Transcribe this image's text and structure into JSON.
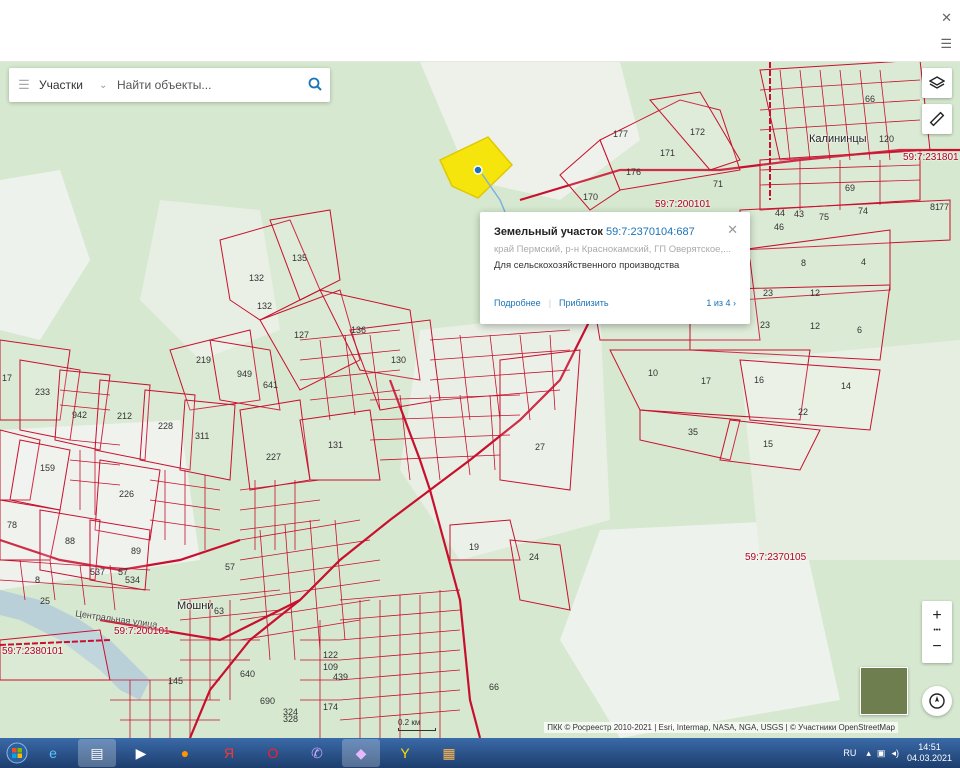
{
  "search": {
    "layer_label": "Участки",
    "placeholder": "Найти объекты..."
  },
  "popup": {
    "title_prefix": "Земельный участок",
    "cadastral_number": "59:7:2370104:687",
    "address": "край Пермский, р-н Краснокамский, ГП Оверятское,...",
    "usage": "Для сельскохозяйственного производства",
    "link_more": "Подробнее",
    "link_zoom": "Приблизить",
    "count": "1 из 4"
  },
  "map": {
    "villages": [
      "Калининцы",
      "Мошни"
    ],
    "street": "Центральная улица",
    "cadastral_quarters": [
      "59:7:231801",
      "59:7:200101",
      "59:7:2370105",
      "59:7:200101",
      "59:7:2380101"
    ],
    "scale_label": "0.2 км",
    "attribution": "ПКК © Росреестр 2010-2021 | Esri, Intermap, NASA, NGA, USGS | © Участники OpenStreetMap",
    "parcel_numbers": [
      "177",
      "172",
      "171",
      "176",
      "170",
      "132",
      "135",
      "132",
      "127",
      "136",
      "130",
      "219",
      "949",
      "641",
      "233",
      "942",
      "212",
      "228",
      "311",
      "17",
      "159",
      "226",
      "227",
      "131",
      "27",
      "78",
      "88",
      "89",
      "10",
      "17",
      "16",
      "14",
      "35",
      "22",
      "15",
      "8",
      "4",
      "23",
      "12",
      "23",
      "12",
      "6",
      "75",
      "74",
      "81",
      "77",
      "44",
      "46",
      "43",
      "19",
      "24",
      "57",
      "8",
      "25",
      "537",
      "534",
      "63",
      "145",
      "122",
      "109",
      "439",
      "174",
      "690",
      "324",
      "328",
      "640",
      "66",
      "120",
      "66",
      "69",
      "71"
    ]
  },
  "controls": {
    "layers_icon": "layers-icon",
    "ruler_icon": "ruler-icon",
    "zoom_in": "+",
    "zoom_more": "•••",
    "zoom_out": "−"
  },
  "taskbar": {
    "lang": "RU",
    "time": "14:51",
    "date": "04.03.2021"
  },
  "colors": {
    "parcel_stroke": "#c8102e",
    "selected_fill": "#f5e50d",
    "link": "#1a73b8",
    "map_green": "#d9ead3"
  }
}
